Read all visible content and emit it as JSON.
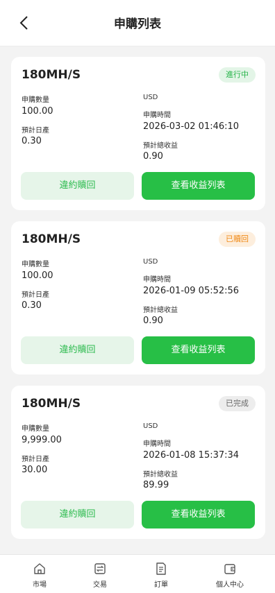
{
  "header": {
    "title": "申購列表"
  },
  "labels": {
    "amount": "申購數量",
    "daily": "預計日產",
    "currency": "USD",
    "time": "申購時間",
    "total_income": "預計總收益"
  },
  "orders": [
    {
      "name": "180MH/S",
      "status": "進行中",
      "amount": "100.00",
      "daily": "0.30",
      "time": "2026-03-02 01:46:10",
      "total_income": "0.90",
      "redeem_label": "違約贖回",
      "view_label": "查看收益列表"
    },
    {
      "name": "180MH/S",
      "status": "已贖回",
      "amount": "100.00",
      "daily": "0.30",
      "time": "2026-01-09 05:52:56",
      "total_income": "0.90",
      "redeem_label": "違約贖回",
      "view_label": "查看收益列表"
    },
    {
      "name": "180MH/S",
      "status": "已完成",
      "amount": "9,999.00",
      "daily": "30.00",
      "time": "2026-01-08 15:37:34",
      "total_income": "89.99",
      "redeem_label": "違約贖回",
      "view_label": "查看收益列表"
    }
  ],
  "nav": [
    {
      "label": "市場",
      "icon": "home-icon"
    },
    {
      "label": "交易",
      "icon": "exchange-icon"
    },
    {
      "label": "訂單",
      "icon": "document-icon"
    },
    {
      "label": "個人中心",
      "icon": "wallet-icon"
    }
  ]
}
